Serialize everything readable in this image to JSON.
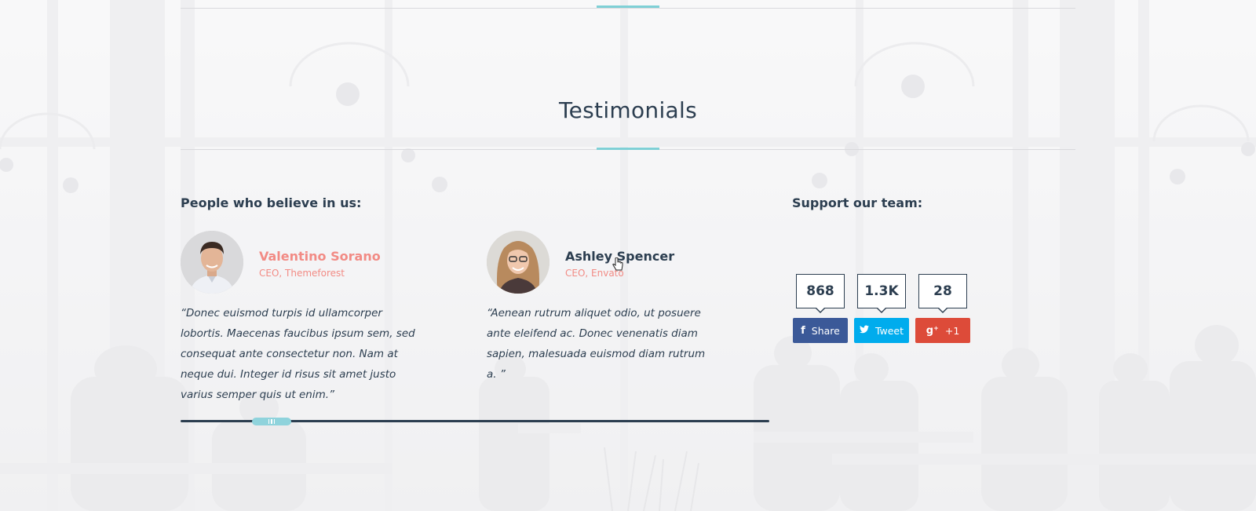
{
  "section": {
    "title": "Testimonials"
  },
  "left_column": {
    "heading": "People who believe in us:"
  },
  "right_column": {
    "heading": "Support our team:"
  },
  "testimonials": [
    {
      "name": "Valentino Sorano",
      "role": "CEO, Themeforest",
      "quote": "“Donec euismod turpis id ullamcorper lobortis. Maecenas faucibus ipsum sem, sed consequat ante consectetur non. Nam at neque dui. Integer id risus sit amet justo varius semper quis ut enim.”",
      "accent_color": "#f28b85"
    },
    {
      "name": "Ashley Spencer",
      "role": "CEO, Envato",
      "quote": "“Aenean rutrum aliquet odio, ut posuere ante eleifend ac. Donec venenatis diam sapien, malesuada euismod diam rutrum a. ”",
      "accent_color": "#f28b85"
    }
  ],
  "social": [
    {
      "network": "facebook",
      "count": "868",
      "label": "Share",
      "icon": "facebook-icon",
      "glyph": "f",
      "color": "#3b5998"
    },
    {
      "network": "twitter",
      "count": "1.3K",
      "label": "Tweet",
      "icon": "twitter-icon",
      "glyph": "❧",
      "color": "#00aced"
    },
    {
      "network": "google-plus",
      "count": "28",
      "label": "+1",
      "icon": "google-plus-icon",
      "glyph": "g⁺",
      "color": "#dd4b39"
    }
  ],
  "colors": {
    "text": "#2c3e50",
    "accent_teal": "#7fd0d6"
  }
}
